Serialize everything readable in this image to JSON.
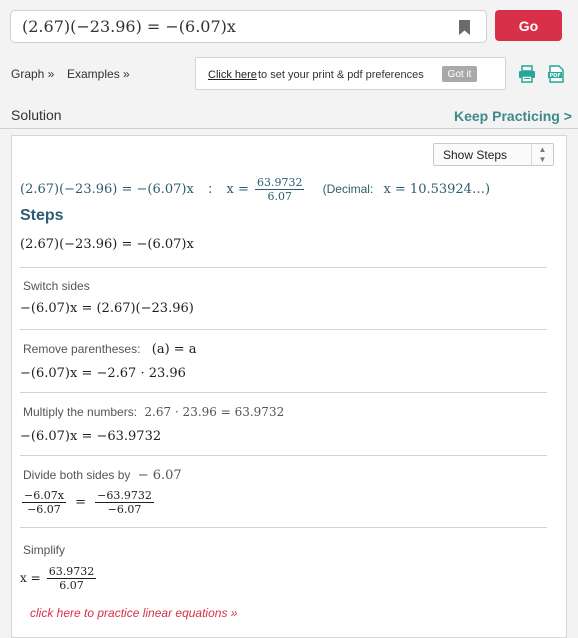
{
  "search": {
    "query": "(2.67)(−23.96) = −(6.07)x"
  },
  "toolbar": {
    "go_label": "Go",
    "bookmark_icon": "bookmark-icon"
  },
  "nav": {
    "graph_label": "Graph »",
    "examples_label": "Examples »",
    "pref_link": "Click here",
    "pref_text": "to set your print & pdf preferences",
    "gotit_label": "Got it"
  },
  "header": {
    "solution_label": "Solution",
    "keep_practicing": "Keep Practicing >"
  },
  "panel": {
    "show_steps_label": "Show Steps",
    "answer": {
      "equation": "(2.67)(−23.96) = −(6.07)x",
      "separator": ":",
      "x_lhs": "x =",
      "frac_num": "63.9732",
      "frac_den": "6.07",
      "decimal_label": "(Decimal:",
      "decimal_value": "x = 10.53924…)"
    },
    "steps_heading": "Steps",
    "steps_equation": "(2.67)(−23.96) = −(6.07)x",
    "steps": [
      {
        "title": "Switch sides",
        "eq": "−(6.07)x = (2.67)(−23.96)"
      },
      {
        "title": "Remove parentheses:",
        "title_math": "(a) = a",
        "eq": "−(6.07)x = −2.67 · 23.96"
      },
      {
        "title": "Multiply the numbers:",
        "title_math": "2.67 · 23.96 = 63.9732",
        "eq": "−(6.07)x = −63.9732"
      },
      {
        "title": "Divide both sides by",
        "title_math": "− 6.07",
        "frac1_num": "−6.07x",
        "frac1_den": "−6.07",
        "eq_sign": "=",
        "frac2_num": "−63.9732",
        "frac2_den": "−6.07"
      },
      {
        "title": "Simplify",
        "x_lhs": "x =",
        "frac_num": "63.9732",
        "frac_den": "6.07"
      }
    ],
    "practice_link": "click here to practice linear equations »"
  },
  "colors": {
    "accent_red": "#d9304a",
    "teal": "#3d8a8a",
    "dark_teal": "#2d5c70"
  }
}
